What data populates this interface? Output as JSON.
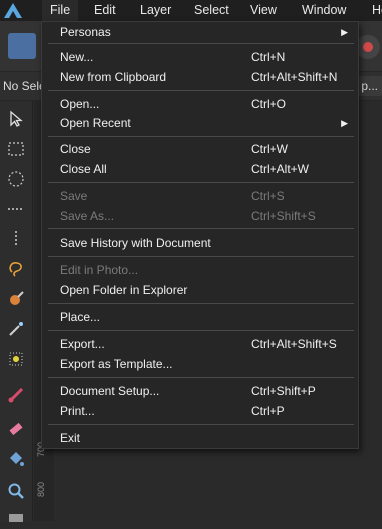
{
  "menubar": {
    "items": [
      "File",
      "Edit",
      "Layer",
      "Select",
      "View",
      "Window",
      "He"
    ]
  },
  "context_bar": {
    "left_text": "No Sele",
    "right_text": "p..."
  },
  "rulers": {
    "labels": [
      "700",
      "800"
    ]
  },
  "file_menu": {
    "items": [
      {
        "label": "Personas",
        "shortcut": "",
        "submenu": true,
        "enabled": true
      },
      {
        "label": "New...",
        "shortcut": "Ctrl+N",
        "submenu": false,
        "enabled": true
      },
      {
        "label": "New from Clipboard",
        "shortcut": "Ctrl+Alt+Shift+N",
        "submenu": false,
        "enabled": true
      },
      {
        "label": "Open...",
        "shortcut": "Ctrl+O",
        "submenu": false,
        "enabled": true
      },
      {
        "label": "Open Recent",
        "shortcut": "",
        "submenu": true,
        "enabled": true
      },
      {
        "label": "Close",
        "shortcut": "Ctrl+W",
        "submenu": false,
        "enabled": true
      },
      {
        "label": "Close All",
        "shortcut": "Ctrl+Alt+W",
        "submenu": false,
        "enabled": true
      },
      {
        "label": "Save",
        "shortcut": "Ctrl+S",
        "submenu": false,
        "enabled": false
      },
      {
        "label": "Save As...",
        "shortcut": "Ctrl+Shift+S",
        "submenu": false,
        "enabled": false
      },
      {
        "label": "Save History with Document",
        "shortcut": "",
        "submenu": false,
        "enabled": true
      },
      {
        "label": "Edit in Photo...",
        "shortcut": "",
        "submenu": false,
        "enabled": false
      },
      {
        "label": "Open Folder in Explorer",
        "shortcut": "",
        "submenu": false,
        "enabled": true
      },
      {
        "label": "Place...",
        "shortcut": "",
        "submenu": false,
        "enabled": true
      },
      {
        "label": "Export...",
        "shortcut": "Ctrl+Alt+Shift+S",
        "submenu": false,
        "enabled": true
      },
      {
        "label": "Export as Template...",
        "shortcut": "",
        "submenu": false,
        "enabled": true
      },
      {
        "label": "Document Setup...",
        "shortcut": "Ctrl+Shift+P",
        "submenu": false,
        "enabled": true
      },
      {
        "label": "Print...",
        "shortcut": "Ctrl+P",
        "submenu": false,
        "enabled": true
      },
      {
        "label": "Exit",
        "shortcut": "",
        "submenu": false,
        "enabled": true
      }
    ]
  },
  "tools": [
    "move-tool-icon",
    "rectangle-marquee-icon",
    "ellipse-marquee-icon",
    "row-marquee-icon",
    "column-marquee-icon",
    "freehand-selection-icon",
    "selection-brush-icon",
    "magic-wand-icon",
    "flood-select-icon",
    "paint-brush-icon",
    "eraser-icon",
    "fill-bucket-icon",
    "zoom-icon",
    "ruler-tool-icon"
  ],
  "colors": {
    "menu_bg": "#262626",
    "menubar_bg": "#1f1f1f",
    "disabled_text": "#7b7b7b",
    "text": "#f0f0f0",
    "accent": "#4a6fa0"
  }
}
